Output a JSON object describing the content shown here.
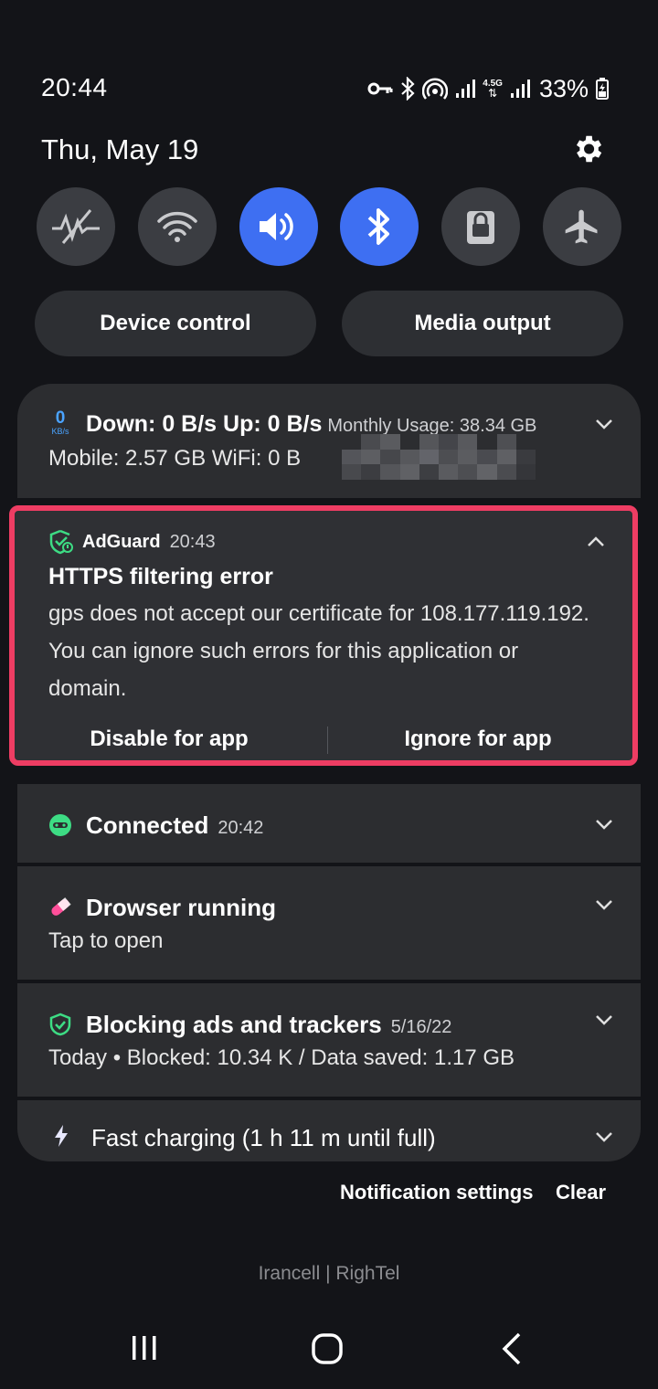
{
  "status_bar": {
    "time": "20:44",
    "battery": "33%",
    "network_label": "4.5G",
    "icons": [
      "vpn-key-icon",
      "bluetooth-icon",
      "hotspot-icon",
      "signal-icon",
      "data-arrows-icon",
      "signal-icon",
      "battery-charging-icon"
    ]
  },
  "header": {
    "date": "Thu, May 19",
    "settings_icon": "gear-icon"
  },
  "quick_settings": [
    {
      "name": "mobile-data-off",
      "icon": "mobile-data-off-icon",
      "active": false
    },
    {
      "name": "wifi",
      "icon": "wifi-icon",
      "active": false
    },
    {
      "name": "sound",
      "icon": "volume-icon",
      "active": true
    },
    {
      "name": "bluetooth",
      "icon": "bluetooth-icon",
      "active": true
    },
    {
      "name": "screen-lock",
      "icon": "lock-icon",
      "active": false
    },
    {
      "name": "airplane-mode",
      "icon": "airplane-icon",
      "active": false
    }
  ],
  "pills": {
    "device_control": "Device control",
    "media_output": "Media output"
  },
  "network_notification": {
    "speed_value": "0",
    "speed_unit": "KB/s",
    "down_up": "Down: 0 B/s  Up: 0 B/s",
    "monthly_usage": "Monthly Usage: 38.34 GB",
    "usage_line": "Mobile: 2.57 GB  WiFi: 0 B"
  },
  "adguard_notification": {
    "app": "AdGuard",
    "time": "20:43",
    "title": "HTTPS filtering error",
    "body": "gps does not accept our certificate for 108.177.119.192. You can ignore such errors for this application or domain.",
    "action_disable": "Disable for app",
    "action_ignore": "Ignore for app",
    "accent": "#ee3d63"
  },
  "connected_notification": {
    "title": "Connected",
    "time": "20:42",
    "icon_color": "#3ddc84"
  },
  "drowser_notification": {
    "title": "Drowser running",
    "subtitle": "Tap to open",
    "icon_color": "#ff4f9a"
  },
  "blocking_notification": {
    "title": "Blocking ads and trackers",
    "date": "5/16/22",
    "subtitle": "Today • Blocked: 10.34 K / Data saved: 1.17 GB",
    "icon_color": "#3ddc84"
  },
  "charging_notification": {
    "title": "Fast charging (1 h 11 m until full)"
  },
  "footer": {
    "notification_settings": "Notification settings",
    "clear": "Clear",
    "carrier": "Irancell | RighTel"
  },
  "nav_bar": [
    "recent-apps-icon",
    "home-icon",
    "back-icon"
  ]
}
